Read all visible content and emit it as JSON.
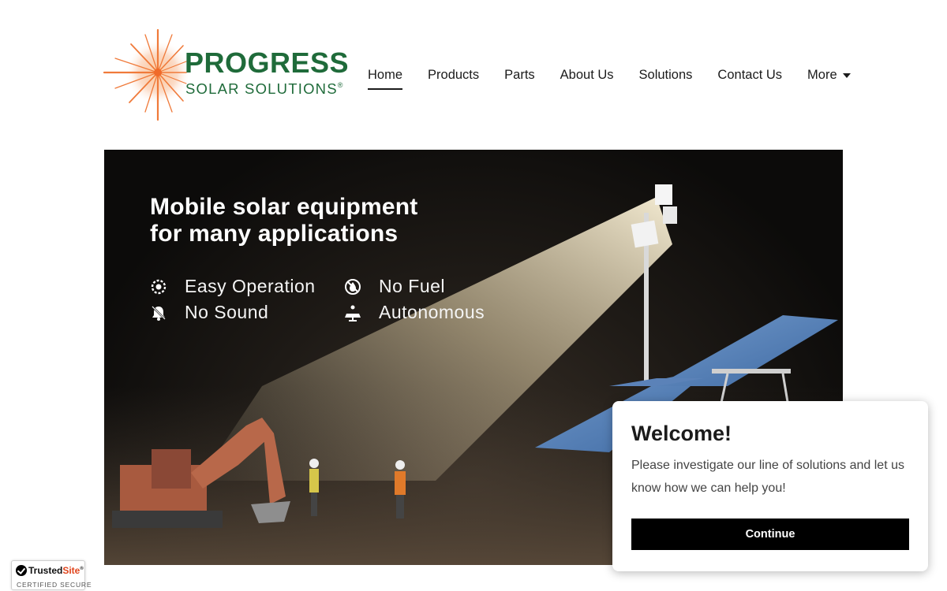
{
  "brand": {
    "name_line1": "PROGRESS",
    "name_line2": "SOLAR SOLUTIONS",
    "registered": "®",
    "colors": {
      "green": "#1f6b3a",
      "orange": "#f07a3a"
    }
  },
  "nav": {
    "items": [
      {
        "label": "Home",
        "active": true
      },
      {
        "label": "Products"
      },
      {
        "label": "Parts"
      },
      {
        "label": "About Us"
      },
      {
        "label": "Solutions"
      },
      {
        "label": "Contact Us"
      }
    ],
    "more_label": "More",
    "more_icon": "caret-down-icon"
  },
  "hero": {
    "title_line1": "Mobile solar equipment",
    "title_line2": "for many applications",
    "features": [
      {
        "label": "Easy Operation",
        "icon": "gear-icon"
      },
      {
        "label": "No Fuel",
        "icon": "no-fuel-icon"
      },
      {
        "label": "No Sound",
        "icon": "muted-bell-icon"
      },
      {
        "label": "Autonomous",
        "icon": "solar-panel-icon"
      }
    ]
  },
  "popup": {
    "title": "Welcome!",
    "text": "Please investigate our line of solutions and let us know how we can help you!",
    "button_label": "Continue"
  },
  "badge": {
    "name_part1": "Trusted",
    "name_part2": "Site",
    "trademark": "®",
    "subtitle": "CERTIFIED SECURE"
  }
}
